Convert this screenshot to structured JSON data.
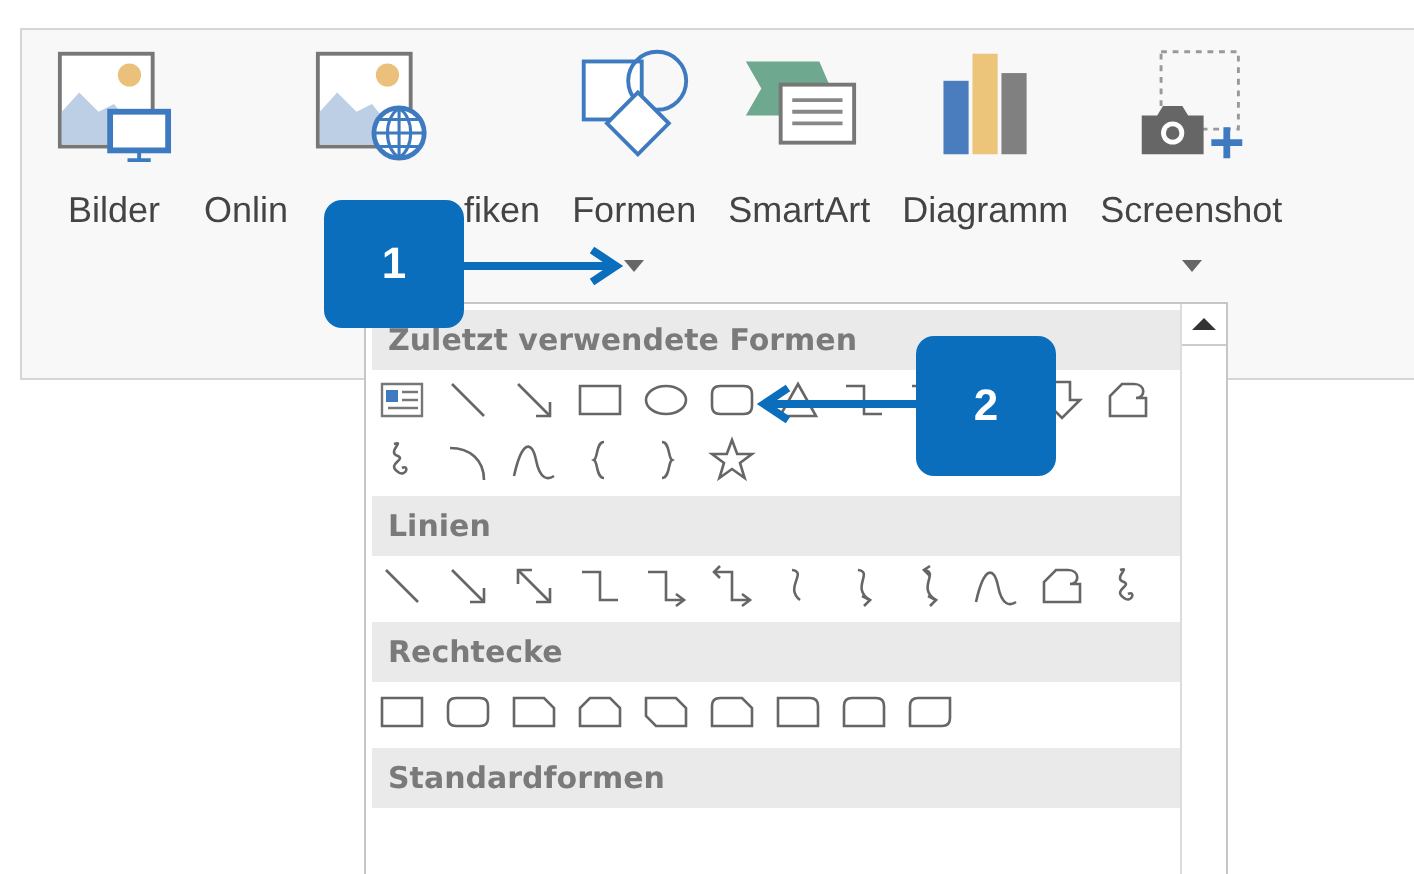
{
  "ribbon": {
    "buttons": [
      {
        "kind": "pictures",
        "label_parts": [
          "Bilder"
        ],
        "dropdown": false
      },
      {
        "kind": "online-pictures",
        "label_parts": [
          "Onlin",
          "fiken"
        ],
        "dropdown": false
      },
      {
        "kind": "shapes",
        "label_parts": [
          "Formen"
        ],
        "dropdown": true
      },
      {
        "kind": "smartart",
        "label_parts": [
          "SmartArt"
        ],
        "dropdown": false
      },
      {
        "kind": "chart",
        "label_parts": [
          "Diagramm"
        ],
        "dropdown": false
      },
      {
        "kind": "screenshot",
        "label_parts": [
          "Screenshot"
        ],
        "dropdown": true
      }
    ]
  },
  "gallery": {
    "sections": [
      {
        "heading": "Zuletzt verwendete Formen"
      },
      {
        "heading": "Linien"
      },
      {
        "heading": "Rechtecke"
      },
      {
        "heading": "Standardformen"
      }
    ]
  },
  "callouts": [
    {
      "number": "1"
    },
    {
      "number": "2"
    }
  ]
}
